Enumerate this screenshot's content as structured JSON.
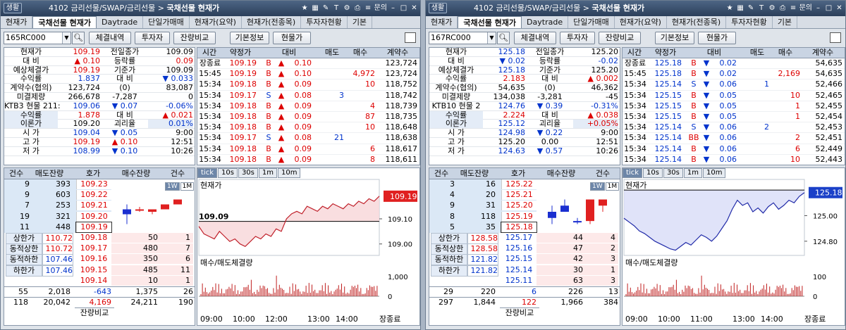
{
  "panels": [
    {
      "title_pre": "4102 금리선물/SWAP/금리선물 > ",
      "title_main": "국채선물 현재가",
      "tabs": [
        "현재가",
        "국채선물 현재가",
        "Daytrade",
        "단일가매매",
        "현재가(요약)",
        "현재가(전종목)",
        "투자자현황",
        "기본"
      ],
      "active_tab": 1,
      "code": "165RC000",
      "buttons": [
        "체결내역",
        "투자자",
        "잔량비교",
        "기본정보",
        "현물가"
      ],
      "info": [
        {
          "l1": "현재가",
          "v1": "109.19",
          "c1": "red",
          "l2": "전일종가",
          "v2": "109.09",
          "c2": ""
        },
        {
          "l1": "대  비",
          "v1": "▲ 0.10",
          "c1": "red",
          "l2": "등락률",
          "v2": "0.09",
          "c2": "red"
        },
        {
          "l1": "예상체결가",
          "v1": "109.19",
          "c1": "red",
          "l2": "기준가",
          "v2": "109.09",
          "c2": ""
        },
        {
          "l1": "수익률",
          "v1": "1.837",
          "c1": "blu",
          "l2": "대  비",
          "v2": "▼ 0.033",
          "c2": "blu"
        },
        {
          "l1": "계약수(협의)",
          "v1": "123,724",
          "c1": "",
          "l2": "(0)",
          "v2": "83,087",
          "c2": ""
        },
        {
          "l1": "미결제량",
          "v1": "266,678",
          "c1": "",
          "l2": "-7,287",
          "v2": "0",
          "c2": ""
        },
        {
          "l1": "KTB3 현물 211:",
          "v1": "109.06",
          "c1": "blu",
          "l2": "▼ 0.07",
          "v2": "-0.06%",
          "c2": "blu"
        },
        {
          "l1": "수익률",
          "v1": "1.878",
          "c1": "red",
          "l2": "대  비",
          "v2": "▲ 0.021",
          "c2": "red"
        },
        {
          "l1": "이론가",
          "v1": "109.20",
          "c1": "",
          "l2": "괴리율",
          "v2": "0.01%",
          "c2": "blu"
        },
        {
          "l1": "시  가",
          "v1": "109.04",
          "c1": "blu",
          "l2": "▼ 0.05",
          "v2": "9:00",
          "c2": ""
        },
        {
          "l1": "고  가",
          "v1": "109.19",
          "c1": "red",
          "l2": "▲ 0.10",
          "v2": "12:51",
          "c2": ""
        },
        {
          "l1": "저  가",
          "v1": "108.99",
          "c1": "blu",
          "l2": "▼ 0.10",
          "v2": "10:26",
          "c2": ""
        }
      ],
      "trade_headers": [
        "시간",
        "약정가",
        "대비",
        "매도",
        "매수",
        "계약수"
      ],
      "trades": [
        [
          "장종료",
          "109.19",
          "B",
          "▲",
          "0.10",
          "",
          "",
          "123,724"
        ],
        [
          "15:45",
          "109.19",
          "B",
          "▲",
          "0.10",
          "",
          "4,972",
          "123,724"
        ],
        [
          "15:34",
          "109.18",
          "B",
          "▲",
          "0.09",
          "",
          "10",
          "118,752"
        ],
        [
          "15:34",
          "109.17",
          "S",
          "▲",
          "0.08",
          "3",
          "",
          "118,742"
        ],
        [
          "15:34",
          "109.18",
          "B",
          "▲",
          "0.09",
          "",
          "4",
          "118,739"
        ],
        [
          "15:34",
          "109.18",
          "B",
          "▲",
          "0.09",
          "",
          "87",
          "118,735"
        ],
        [
          "15:34",
          "109.18",
          "B",
          "▲",
          "0.09",
          "",
          "10",
          "118,648"
        ],
        [
          "15:34",
          "109.17",
          "S",
          "▲",
          "0.08",
          "21",
          "",
          "118,638"
        ],
        [
          "15:34",
          "109.18",
          "B",
          "▲",
          "0.09",
          "",
          "6",
          "118,617"
        ],
        [
          "15:34",
          "109.18",
          "B",
          "▲",
          "0.09",
          "",
          "8",
          "118,611"
        ]
      ],
      "ob_headers": [
        "건수",
        "매도잔량",
        "호가",
        "매수잔량",
        "건수"
      ],
      "asks": [
        [
          "9",
          "393",
          "109.23"
        ],
        [
          "9",
          "603",
          "109.22"
        ],
        [
          "7",
          "253",
          "109.21"
        ],
        [
          "19",
          "321",
          "109.20"
        ],
        [
          "11",
          "448",
          "109.19"
        ]
      ],
      "bids": [
        [
          "109.18",
          "50",
          "1"
        ],
        [
          "109.17",
          "480",
          "7"
        ],
        [
          "109.16",
          "350",
          "6"
        ],
        [
          "109.15",
          "485",
          "11"
        ],
        [
          "109.14",
          "10",
          "1"
        ]
      ],
      "limits": [
        [
          "상한가",
          "110.72"
        ],
        [
          "동적상한",
          "110.72"
        ],
        [
          "동적하한",
          "107.46"
        ],
        [
          "하한가",
          "107.46"
        ]
      ],
      "sum1": [
        "55",
        "2,018",
        "-643",
        "1,375",
        "26"
      ],
      "sum2": [
        "118",
        "20,042",
        "4,169",
        "24,211",
        "190"
      ],
      "cmp_label": "잔량비교",
      "chart_tabs": [
        "tick",
        "10s",
        "30s",
        "1m",
        "10m"
      ],
      "wm": [
        "1W",
        "1M"
      ],
      "chart_title": "현재가",
      "vol_title": "매수/매도체결량",
      "prev_close_label": "109.09",
      "last_price": "109.19",
      "chart_data": {
        "type": "line",
        "ylim": [
          108.96,
          109.24
        ],
        "yticks": [
          "109.10",
          "109.00"
        ],
        "prev_close": 109.09,
        "x": [
          "09:00",
          "10:00",
          "12:00",
          "13:00",
          "14:00",
          "장종료"
        ],
        "values": [
          109.07,
          109.04,
          109.03,
          109.02,
          109.05,
          109.03,
          109.01,
          109.02,
          109.0,
          108.99,
          109.01,
          109.03,
          109.02,
          109.04,
          109.03,
          109.06,
          109.05,
          109.1,
          109.12,
          109.13,
          109.12,
          109.15,
          109.14,
          109.13,
          109.15,
          109.14,
          109.16,
          109.15,
          109.14,
          109.16,
          109.15,
          109.17,
          109.16,
          109.18,
          109.17,
          109.19
        ],
        "vol_yticks": [
          "1,000",
          "0"
        ]
      },
      "candles": [
        {
          "o": 109.17,
          "c": 109.18,
          "h": 109.19,
          "l": 109.15,
          "col": "blue"
        },
        {
          "o": 109.18,
          "c": 109.18,
          "h": 109.185,
          "l": 109.175,
          "col": "red"
        },
        {
          "o": 109.175,
          "c": 109.18,
          "h": 109.18,
          "l": 109.17,
          "col": "red"
        },
        {
          "o": 109.18,
          "c": 109.19,
          "h": 109.19,
          "l": 109.18,
          "col": "red"
        },
        {
          "o": 109.19,
          "c": 109.2,
          "h": 109.2,
          "l": 109.19,
          "col": "red"
        }
      ]
    },
    {
      "title_pre": "4102 금리선물/SWAP/금리선물 > ",
      "title_main": "국채선물 현재가",
      "tabs": [
        "현재가",
        "국채선물 현재가",
        "Daytrade",
        "단일가매매",
        "현재가(요약)",
        "현재가(전종목)",
        "투자자현황",
        "기본"
      ],
      "active_tab": 1,
      "code": "167RC000",
      "buttons": [
        "체결내역",
        "투자자",
        "잔량비교",
        "기본정보",
        "현물가"
      ],
      "info": [
        {
          "l1": "현재가",
          "v1": "125.18",
          "c1": "blu",
          "l2": "전일종가",
          "v2": "125.20",
          "c2": ""
        },
        {
          "l1": "대  비",
          "v1": "▼ 0.02",
          "c1": "blu",
          "l2": "등락률",
          "v2": "-0.02",
          "c2": "blu"
        },
        {
          "l1": "예상체결가",
          "v1": "125.18",
          "c1": "blu",
          "l2": "기준가",
          "v2": "125.20",
          "c2": ""
        },
        {
          "l1": "수익률",
          "v1": "2.183",
          "c1": "red",
          "l2": "대  비",
          "v2": "▲ 0.002",
          "c2": "red"
        },
        {
          "l1": "계약수(협의)",
          "v1": "54,635",
          "c1": "",
          "l2": "(0)",
          "v2": "46,362",
          "c2": ""
        },
        {
          "l1": "미결제량",
          "v1": "134,038",
          "c1": "",
          "l2": "-3,281",
          "v2": "-45",
          "c2": ""
        },
        {
          "l1": "KTB10 현물 2",
          "v1": "124.76",
          "c1": "blu",
          "l2": "▼ 0.39",
          "v2": "-0.31%",
          "c2": "blu"
        },
        {
          "l1": "수익률",
          "v1": "2.224",
          "c1": "red",
          "l2": "대  비",
          "v2": "▲ 0.038",
          "c2": "red"
        },
        {
          "l1": "이론가",
          "v1": "125.12",
          "c1": "blu",
          "l2": "괴리율",
          "v2": "+0.05%",
          "c2": "red"
        },
        {
          "l1": "시  가",
          "v1": "124.98",
          "c1": "blu",
          "l2": "▼ 0.22",
          "v2": "9:00",
          "c2": ""
        },
        {
          "l1": "고  가",
          "v1": "125.20",
          "c1": "",
          "l2": "0.00",
          "v2": "12:51",
          "c2": ""
        },
        {
          "l1": "저  가",
          "v1": "124.63",
          "c1": "blu",
          "l2": "▼ 0.57",
          "v2": "10:26",
          "c2": ""
        }
      ],
      "trade_headers": [
        "시간",
        "약정가",
        "대비",
        "매도",
        "매수",
        "계약수"
      ],
      "trades": [
        [
          "장종료",
          "125.18",
          "B",
          "▼",
          "0.02",
          "",
          "",
          "54,635"
        ],
        [
          "15:45",
          "125.18",
          "B",
          "▼",
          "0.02",
          "",
          "2,169",
          "54,635"
        ],
        [
          "15:34",
          "125.14",
          "S",
          "▼",
          "0.06",
          "1",
          "",
          "52,466"
        ],
        [
          "15:34",
          "125.15",
          "B",
          "▼",
          "0.05",
          "",
          "10",
          "52,465"
        ],
        [
          "15:34",
          "125.15",
          "B",
          "▼",
          "0.05",
          "",
          "1",
          "52,455"
        ],
        [
          "15:34",
          "125.15",
          "B",
          "▼",
          "0.05",
          "",
          "1",
          "52,454"
        ],
        [
          "15:34",
          "125.14",
          "S",
          "▼",
          "0.06",
          "2",
          "",
          "52,453"
        ],
        [
          "15:34",
          "125.14",
          "BB",
          "▼",
          "0.06",
          "",
          "2",
          "52,451"
        ],
        [
          "15:34",
          "125.14",
          "B",
          "▼",
          "0.06",
          "",
          "6",
          "52,449"
        ],
        [
          "15:34",
          "125.14",
          "B",
          "▼",
          "0.06",
          "",
          "10",
          "52,443"
        ]
      ],
      "ob_headers": [
        "건수",
        "매도잔량",
        "호가",
        "매수잔량",
        "건수"
      ],
      "asks": [
        [
          "3",
          "16",
          "125.22"
        ],
        [
          "4",
          "20",
          "125.21"
        ],
        [
          "9",
          "31",
          "125.20"
        ],
        [
          "8",
          "118",
          "125.19"
        ],
        [
          "5",
          "35",
          "125.18"
        ]
      ],
      "bids": [
        [
          "125.17",
          "44",
          "4"
        ],
        [
          "125.16",
          "47",
          "2"
        ],
        [
          "125.15",
          "42",
          "3"
        ],
        [
          "125.14",
          "30",
          "1"
        ],
        [
          "125.11",
          "63",
          "3"
        ]
      ],
      "limits": [
        [
          "상한가",
          "128.58"
        ],
        [
          "동적상한",
          "128.58"
        ],
        [
          "동적하한",
          "121.82"
        ],
        [
          "하한가",
          "121.82"
        ]
      ],
      "sum1": [
        "29",
        "220",
        "6",
        "226",
        "13"
      ],
      "sum2": [
        "297",
        "1,844",
        "122",
        "1,966",
        "384"
      ],
      "cmp_label": "잔량비교",
      "chart_tabs": [
        "tick",
        "10s",
        "30s",
        "1m",
        "10m"
      ],
      "wm": [
        "1W",
        "1M"
      ],
      "chart_title": "현재가",
      "vol_title": "매수/매도체결량",
      "prev_close_label": "",
      "last_price": "125.18",
      "chart_data": {
        "type": "line",
        "ylim": [
          124.7,
          125.25
        ],
        "yticks": [
          "125.00",
          "124.80"
        ],
        "prev_close": 125.2,
        "x": [
          "09:00",
          "10:00",
          "11:00",
          "13:00",
          "14:00",
          "장종료"
        ],
        "values": [
          124.98,
          124.95,
          124.92,
          124.88,
          124.86,
          124.83,
          124.8,
          124.78,
          124.76,
          124.74,
          124.73,
          124.76,
          124.79,
          124.77,
          124.81,
          124.85,
          124.83,
          124.8,
          124.84,
          124.9,
          124.96,
          125.05,
          125.12,
          125.08,
          125.1,
          125.03,
          125.06,
          125.02,
          125.07,
          125.1,
          125.05,
          125.08,
          125.12,
          125.1,
          125.15,
          125.18
        ],
        "vol_yticks": [
          "100",
          "0"
        ]
      },
      "candles": [
        {
          "o": 125.17,
          "c": 125.18,
          "h": 125.19,
          "l": 125.16,
          "col": "blue"
        },
        {
          "o": 125.18,
          "c": 125.19,
          "h": 125.2,
          "l": 125.18,
          "col": "blue"
        },
        {
          "o": 125.165,
          "c": 125.165,
          "h": 125.17,
          "l": 125.16,
          "col": "blue"
        },
        {
          "o": 125.165,
          "c": 125.2,
          "h": 125.2,
          "l": 125.16,
          "col": "red"
        },
        {
          "o": 125.2,
          "c": 125.19,
          "h": 125.2,
          "l": 125.18,
          "col": "red"
        }
      ]
    }
  ]
}
